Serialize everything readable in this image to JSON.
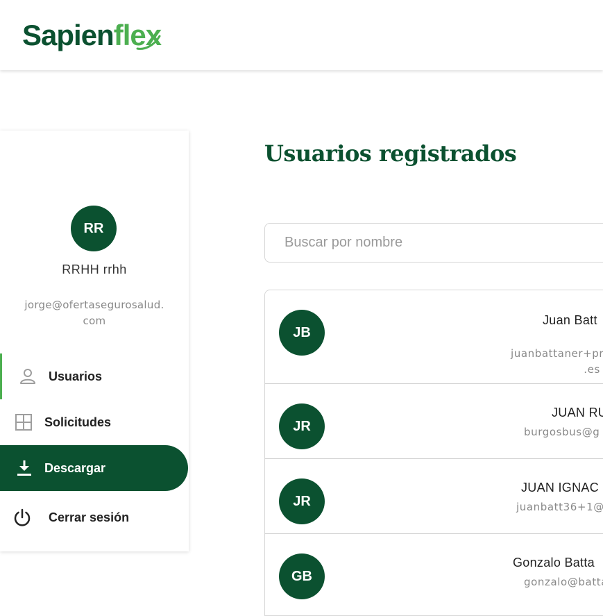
{
  "brand": {
    "name_part1": "Sapien",
    "name_part2": "flex",
    "primary_color": "#0b5130",
    "accent_color": "#4caf50"
  },
  "sidebar": {
    "user": {
      "initials": "RR",
      "name": "RRHH rrhh",
      "email_line1": "jorge@ofertasegurosalud.",
      "email_line2": "com"
    },
    "items": [
      {
        "label": "Usuarios",
        "icon": "person-icon",
        "state": "selected"
      },
      {
        "label": "Solicitudes",
        "icon": "grid-icon",
        "state": "normal"
      },
      {
        "label": "Descargar",
        "icon": "download-icon",
        "state": "highlighted"
      },
      {
        "label": "Cerrar sesión",
        "icon": "power-icon",
        "state": "normal"
      }
    ]
  },
  "main": {
    "title": "Usuarios registrados",
    "search_placeholder": "Buscar por nombre",
    "users": [
      {
        "initials": "JB",
        "name": "Juan Batt",
        "email_line1": "juanbattaner+pr",
        "email_line2": ".es"
      },
      {
        "initials": "JR",
        "name": "JUAN RU",
        "email_line1": "burgosbus@g",
        "email_line2": ""
      },
      {
        "initials": "JR",
        "name": "JUAN IGNAC",
        "email_line1": "juanbatt36+1@",
        "email_line2": ""
      },
      {
        "initials": "GB",
        "name": "Gonzalo Batta",
        "email_line1": "gonzalo@batta",
        "email_line2": ""
      }
    ]
  }
}
